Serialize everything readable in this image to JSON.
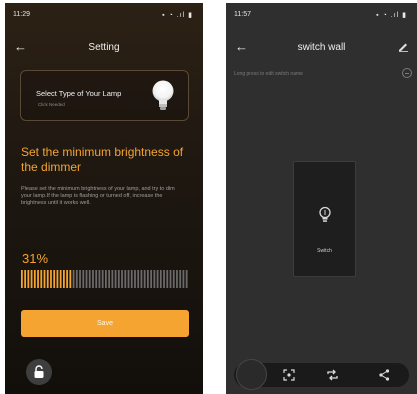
{
  "left_screen": {
    "status_time": "11:29",
    "status_right": "▪ ◔ .ıl ▮",
    "title": "Setting",
    "lamp_card": {
      "title": "Select Type of Your Lamp",
      "subtitle": "Click Needed"
    },
    "heading": "Set the minimum brightness of the dimmer",
    "description": "Please set the minimum brightness of your lamp, and try to dim your lamp.If the lamp is flashing or turned off, increase the brightness until it works well.",
    "brightness_percent_label": "31%",
    "brightness_fraction": 0.31,
    "save_label": "Save",
    "accent_color": "#f5a431"
  },
  "right_screen": {
    "status_time": "11:57",
    "status_right": "▪ ◔ .ıl ▮",
    "title": "switch wall",
    "hint": "Long press to edit switch name",
    "switch_label": "Switch"
  },
  "icons": [
    "back-arrow-icon",
    "bulb-icon",
    "lock-icon",
    "pencil-icon",
    "info-icon",
    "screenshot-icon",
    "swap-icon",
    "share-icon"
  ]
}
